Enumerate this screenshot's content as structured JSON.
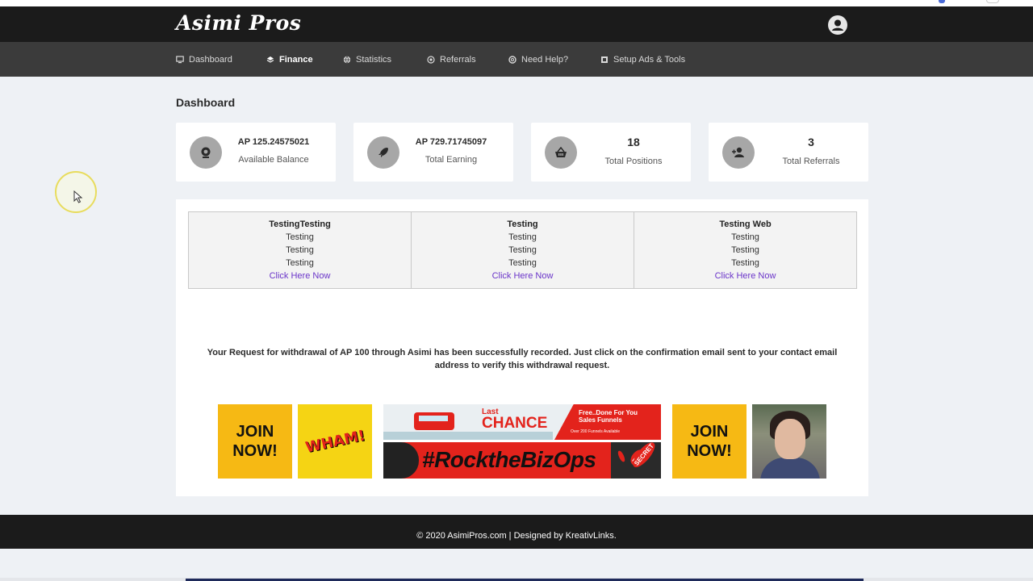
{
  "app": {
    "logo_text": "Asimi Pros"
  },
  "nav": {
    "items": [
      {
        "label": "Dashboard",
        "icon": "monitor-icon",
        "active": false
      },
      {
        "label": "Finance",
        "icon": "layers-icon",
        "active": true
      },
      {
        "label": "Statistics",
        "icon": "globe-icon",
        "active": false
      },
      {
        "label": "Referrals",
        "icon": "at-sign-icon",
        "active": false
      },
      {
        "label": "Need Help?",
        "icon": "lifebuoy-icon",
        "active": false
      },
      {
        "label": "Setup Ads & Tools",
        "icon": "tools-icon",
        "active": false
      }
    ]
  },
  "page": {
    "title": "Dashboard"
  },
  "stats": [
    {
      "value": "AP 125.24575021",
      "label": "Available Balance",
      "icon": "webcam-icon"
    },
    {
      "value": "AP 729.71745097",
      "label": "Total Earning",
      "icon": "rocket-icon"
    },
    {
      "value": "18",
      "label": "Total Positions",
      "icon": "basket-icon"
    },
    {
      "value": "3",
      "label": "Total Referrals",
      "icon": "user-add-icon"
    }
  ],
  "text_ads": [
    {
      "title": "TestingTesting",
      "lines": [
        "Testing",
        "Testing",
        "Testing"
      ],
      "link": "Click Here Now"
    },
    {
      "title": "Testing",
      "lines": [
        "Testing",
        "Testing",
        "Testing"
      ],
      "link": "Click Here Now"
    },
    {
      "title": "Testing Web",
      "lines": [
        "Testing",
        "Testing",
        "Testing"
      ],
      "link": "Click Here Now"
    }
  ],
  "message": "Your Request for withdrawal of AP 100 through Asimi has been successfully recorded. Just click on the confirmation email sent to your contact email address to verify this withdrawal request.",
  "banners": {
    "join1": {
      "line1": "JOIN",
      "line2": "NOW!"
    },
    "wham": "WHAM!",
    "combo": {
      "last": "Last",
      "chance": "CHANCE",
      "free": "Free..Done For You",
      "funnels": "Sales Funnels",
      "small": "Over 200 Funnels Available",
      "hashtag": "#RocktheBizOps",
      "secret1": "TOP",
      "secret2": "SECRET"
    },
    "join2": {
      "line1": "JOIN",
      "line2": "NOW!"
    }
  },
  "footer": {
    "text": "© 2020 AsimiPros.com | Designed by KreativLinks."
  },
  "colors": {
    "header_bg": "#1b1b1b",
    "nav_bg": "#3b3b3b",
    "page_bg": "#eef1f5",
    "link": "#6a34c9",
    "banner_yellow": "#f6b914",
    "banner_red": "#e3231c"
  }
}
